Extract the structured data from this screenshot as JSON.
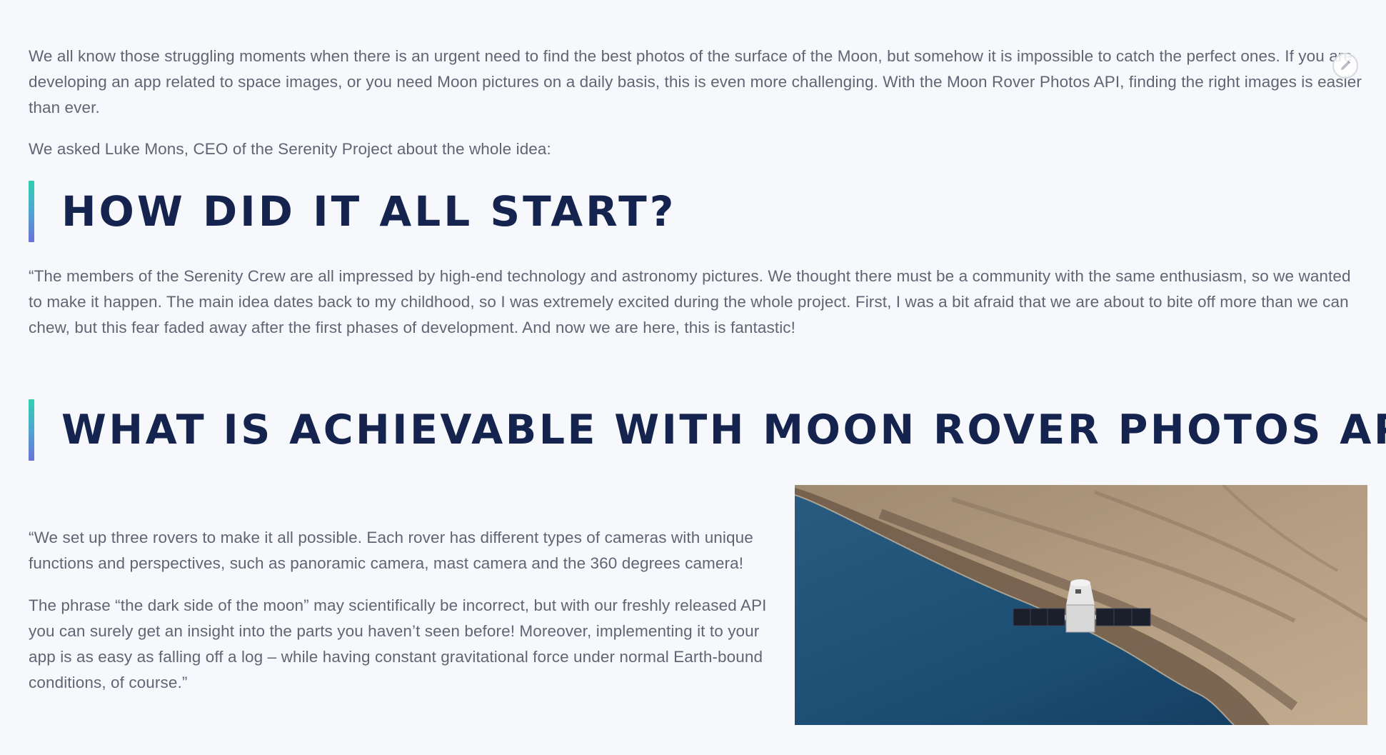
{
  "article": {
    "intro": "We all know those struggling moments when there is an urgent need to find the best photos of  the surface of the Moon, but somehow it is impossible to catch the perfect ones. If you are developing an app related to space images, or you need Moon pictures on a daily basis, this is even more challenging. With the Moon Rover Photos API, finding the right images is easier than ever.",
    "ask": "We asked Luke Mons, CEO of the Serenity Project about the whole idea:",
    "heading_start": "HOW DID IT ALL START?",
    "quote_start": "“The members of the Serenity Crew are all impressed by high-end technology and astronomy pictures. We thought there must be a community with the same enthusiasm, so we wanted to make it happen. The main idea dates back to my childhood, so I was extremely excited during the whole project. First, I was a bit afraid that we are about to bite off more than we can chew, but this fear faded away after the first phases of development. And now we are here, this is fantastic!",
    "heading_achievable": "WHAT IS ACHIEVABLE WITH MOON ROVER PHOTOS API?",
    "rovers": "“We set up three rovers to make it all possible. Each rover has different types of cameras with unique functions and perspectives, such as panoramic camera, mast camera and the 360 degrees camera!",
    "phrase": "The phrase “the dark side of the moon” may scientifically be incorrect, but with our freshly released API you can surely get an insight into the parts you haven’t seen before! Moreover, implementing it to your app is as easy as falling off a log – while having constant gravitational force under normal Earth-bound conditions, of course.”"
  },
  "image": {
    "subject": "spacecraft-over-coastline-photo"
  },
  "controls": {
    "edit_icon": "pencil-icon"
  },
  "colors": {
    "background": "#f7f8fc",
    "body_text": "#5f6673",
    "heading": "#14244f",
    "accent_top": "#2fd0b0",
    "accent_bottom": "#6b72d8"
  }
}
